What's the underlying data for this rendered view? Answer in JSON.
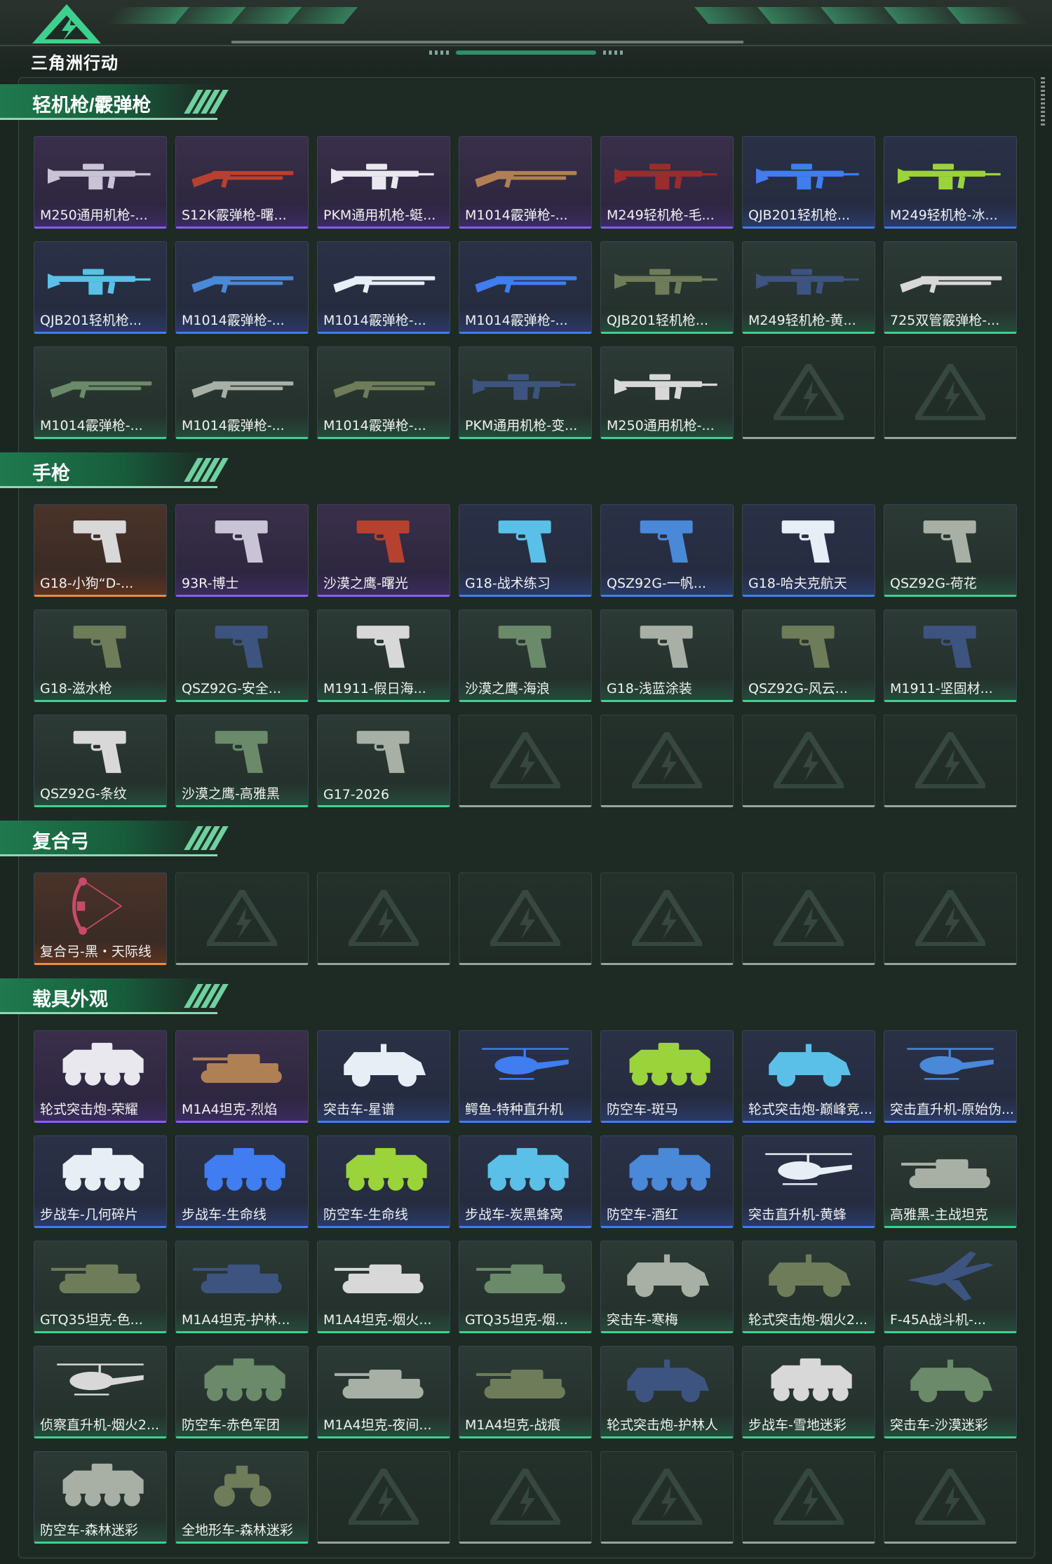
{
  "header": {
    "logo_text": "三角洲行动",
    "logo_icon": "delta-triangle-icon",
    "accent": "#3fd08f"
  },
  "rarity_colors": {
    "purple": "#8a5cff",
    "blue": "#3f7df0",
    "green": "#3fd08f",
    "orange": "#f08a3c",
    "empty": "#9aa29e"
  },
  "sections": [
    {
      "title": "轻机枪/霰弹枪",
      "items": [
        {
          "name": "M250通用机枪-...",
          "rarity": "p",
          "icon": "machine-gun-icon"
        },
        {
          "name": "S12K霰弹枪-曙...",
          "rarity": "p",
          "icon": "shotgun-icon"
        },
        {
          "name": "PKM通用机枪-蜓...",
          "rarity": "p",
          "icon": "machine-gun-icon"
        },
        {
          "name": "M1014霰弹枪-...",
          "rarity": "p",
          "icon": "shotgun-icon"
        },
        {
          "name": "M249轻机枪-毛...",
          "rarity": "p",
          "icon": "machine-gun-icon"
        },
        {
          "name": "QJB201轻机枪...",
          "rarity": "b",
          "icon": "machine-gun-icon"
        },
        {
          "name": "M249轻机枪-冰...",
          "rarity": "b",
          "icon": "machine-gun-icon"
        },
        {
          "name": "QJB201轻机枪...",
          "rarity": "b",
          "icon": "machine-gun-icon"
        },
        {
          "name": "M1014霰弹枪-...",
          "rarity": "b",
          "icon": "shotgun-icon"
        },
        {
          "name": "M1014霰弹枪-...",
          "rarity": "b",
          "icon": "shotgun-icon"
        },
        {
          "name": "M1014霰弹枪-...",
          "rarity": "b",
          "icon": "shotgun-icon"
        },
        {
          "name": "QJB201轻机枪...",
          "rarity": "g",
          "icon": "machine-gun-icon"
        },
        {
          "name": "M249轻机枪-黄...",
          "rarity": "g",
          "icon": "machine-gun-icon"
        },
        {
          "name": "725双管霰弹枪-...",
          "rarity": "g",
          "icon": "shotgun-icon"
        },
        {
          "name": "M1014霰弹枪-...",
          "rarity": "g",
          "icon": "shotgun-icon"
        },
        {
          "name": "M1014霰弹枪-...",
          "rarity": "g",
          "icon": "shotgun-icon"
        },
        {
          "name": "M1014霰弹枪-...",
          "rarity": "g",
          "icon": "shotgun-icon"
        },
        {
          "name": "PKM通用机枪-变...",
          "rarity": "g",
          "icon": "machine-gun-icon"
        },
        {
          "name": "M250通用机枪-...",
          "rarity": "g",
          "icon": "machine-gun-icon"
        }
      ]
    },
    {
      "title": "手枪",
      "items": [
        {
          "name": "G18-小狗“D-...",
          "rarity": "o",
          "icon": "pistol-icon"
        },
        {
          "name": "93R-博士",
          "rarity": "p",
          "icon": "pistol-icon"
        },
        {
          "name": "沙漠之鹰-曙光",
          "rarity": "p",
          "icon": "pistol-icon"
        },
        {
          "name": "G18-战术练习",
          "rarity": "b",
          "icon": "pistol-icon"
        },
        {
          "name": "QSZ92G-一帆...",
          "rarity": "b",
          "icon": "pistol-icon"
        },
        {
          "name": "G18-哈夫克航天",
          "rarity": "b",
          "icon": "pistol-icon"
        },
        {
          "name": "QSZ92G-荷花",
          "rarity": "g",
          "icon": "pistol-icon"
        },
        {
          "name": "G18-滋水枪",
          "rarity": "g",
          "icon": "pistol-icon"
        },
        {
          "name": "QSZ92G-安全...",
          "rarity": "g",
          "icon": "pistol-icon"
        },
        {
          "name": "M1911-假日海...",
          "rarity": "g",
          "icon": "pistol-icon"
        },
        {
          "name": "沙漠之鹰-海浪",
          "rarity": "g",
          "icon": "pistol-icon"
        },
        {
          "name": "G18-浅蓝涂装",
          "rarity": "g",
          "icon": "pistol-icon"
        },
        {
          "name": "QSZ92G-风云...",
          "rarity": "g",
          "icon": "pistol-icon"
        },
        {
          "name": "M1911-坚固材...",
          "rarity": "g",
          "icon": "pistol-icon"
        },
        {
          "name": "QSZ92G-条纹",
          "rarity": "g",
          "icon": "pistol-icon"
        },
        {
          "name": "沙漠之鹰-高雅黑",
          "rarity": "g",
          "icon": "pistol-icon"
        },
        {
          "name": "G17-2026",
          "rarity": "g",
          "icon": "pistol-icon"
        }
      ]
    },
    {
      "title": "复合弓",
      "items": [
        {
          "name": "复合弓-黑・天际线",
          "rarity": "o",
          "icon": "compound-bow-icon"
        }
      ]
    },
    {
      "title": "载具外观",
      "items": [
        {
          "name": "轮式突击炮-荣耀",
          "rarity": "p",
          "icon": "wheeled-vehicle-icon"
        },
        {
          "name": "M1A4坦克-烈焰",
          "rarity": "p",
          "icon": "tank-icon"
        },
        {
          "name": "突击车-星谱",
          "rarity": "b",
          "icon": "assault-car-icon"
        },
        {
          "name": "鳄鱼-特种直升机",
          "rarity": "b",
          "icon": "helicopter-icon"
        },
        {
          "name": "防空车-斑马",
          "rarity": "b",
          "icon": "wheeled-vehicle-icon"
        },
        {
          "name": "轮式突击炮-巅峰竞...",
          "rarity": "b",
          "icon": "assault-car-icon"
        },
        {
          "name": "突击直升机-原始伪...",
          "rarity": "b",
          "icon": "helicopter-icon"
        },
        {
          "name": "步战车-几何碎片",
          "rarity": "b",
          "icon": "wheeled-vehicle-icon"
        },
        {
          "name": "步战车-生命线",
          "rarity": "b",
          "icon": "wheeled-vehicle-icon"
        },
        {
          "name": "防空车-生命线",
          "rarity": "b",
          "icon": "wheeled-vehicle-icon"
        },
        {
          "name": "步战车-炭黑蜂窝",
          "rarity": "b",
          "icon": "wheeled-vehicle-icon"
        },
        {
          "name": "防空车-酒红",
          "rarity": "b",
          "icon": "wheeled-vehicle-icon"
        },
        {
          "name": "突击直升机-黄蜂",
          "rarity": "b",
          "icon": "helicopter-icon"
        },
        {
          "name": "高雅黑-主战坦克",
          "rarity": "g",
          "icon": "tank-icon"
        },
        {
          "name": "GTQ35坦克-色...",
          "rarity": "g",
          "icon": "tank-icon"
        },
        {
          "name": "M1A4坦克-护林...",
          "rarity": "g",
          "icon": "tank-icon"
        },
        {
          "name": "M1A4坦克-烟火...",
          "rarity": "g",
          "icon": "tank-icon"
        },
        {
          "name": "GTQ35坦克-烟...",
          "rarity": "g",
          "icon": "tank-icon"
        },
        {
          "name": "突击车-寒梅",
          "rarity": "g",
          "icon": "assault-car-icon"
        },
        {
          "name": "轮式突击炮-烟火2...",
          "rarity": "g",
          "icon": "assault-car-icon"
        },
        {
          "name": "F-45A战斗机-...",
          "rarity": "g",
          "icon": "fighter-jet-icon"
        },
        {
          "name": "侦察直升机-烟火2...",
          "rarity": "g",
          "icon": "helicopter-icon"
        },
        {
          "name": "防空车-赤色军团",
          "rarity": "g",
          "icon": "wheeled-vehicle-icon"
        },
        {
          "name": "M1A4坦克-夜间...",
          "rarity": "g",
          "icon": "tank-icon"
        },
        {
          "name": "M1A4坦克-战痕",
          "rarity": "g",
          "icon": "tank-icon"
        },
        {
          "name": "轮式突击炮-护林人",
          "rarity": "g",
          "icon": "assault-car-icon"
        },
        {
          "name": "步战车-雪地迷彩",
          "rarity": "g",
          "icon": "wheeled-vehicle-icon"
        },
        {
          "name": "突击车-沙漠迷彩",
          "rarity": "g",
          "icon": "assault-car-icon"
        },
        {
          "name": "防空车-森林迷彩",
          "rarity": "g",
          "icon": "wheeled-vehicle-icon"
        },
        {
          "name": "全地形车-森林迷彩",
          "rarity": "g",
          "icon": "atv-icon"
        }
      ]
    }
  ]
}
